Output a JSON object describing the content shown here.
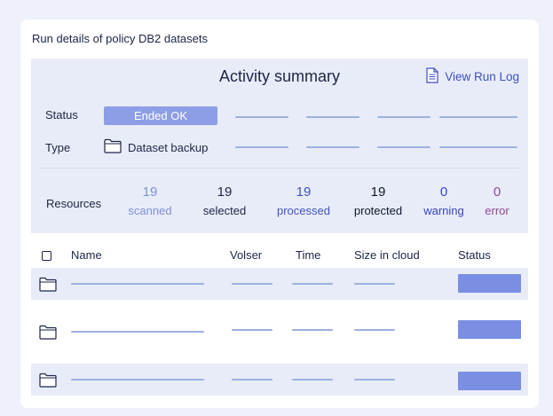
{
  "card": {
    "title": "Run details of policy DB2 datasets"
  },
  "summary": {
    "title": "Activity summary",
    "view_log_label": "View Run Log",
    "status_label": "Status",
    "status_value": "Ended OK",
    "type_label": "Type",
    "type_value": "Dataset backup",
    "resources_label": "Resources",
    "resources": [
      {
        "value": "19",
        "label": "scanned",
        "color": "#7f8fd6"
      },
      {
        "value": "19",
        "label": "selected",
        "color": "#1e2546"
      },
      {
        "value": "19",
        "label": "processed",
        "color": "#4252c4"
      },
      {
        "value": "19",
        "label": "protected",
        "color": "#10182f"
      },
      {
        "value": "0",
        "label": "warning",
        "color": "#3a43c9"
      },
      {
        "value": "0",
        "label": "error",
        "color": "#8e4a8e"
      }
    ]
  },
  "table": {
    "columns": [
      "Name",
      "Volser",
      "Time",
      "Size in cloud",
      "Status"
    ],
    "row_count": 3
  },
  "colors": {
    "accent": "#3f4fbf",
    "placeholder": "#9eb0e3",
    "status_badge": "#7a8fe4",
    "panel": "#e8ecf8"
  }
}
